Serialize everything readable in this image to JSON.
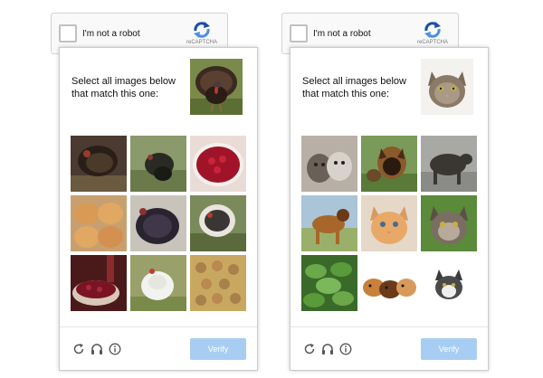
{
  "captchas": [
    {
      "checkbox_label": "I'm not a robot",
      "brand": "reCAPTCHA",
      "prompt": "Select all images below that match this one:",
      "target": "turkey",
      "tiles": [
        "turkey",
        "turkey",
        "cranberries",
        "bread-rolls",
        "turkey",
        "turkey",
        "cranberry-dish",
        "turkey",
        "nuts"
      ],
      "footer_icons": [
        "refresh-icon",
        "headphones-icon",
        "info-icon"
      ],
      "verify_label": "Verify"
    },
    {
      "checkbox_label": "I'm not a robot",
      "brand": "reCAPTCHA",
      "prompt": "Select all images below that match this one:",
      "target": "cat",
      "tiles": [
        "kittens",
        "dog",
        "dog",
        "dog",
        "kitten",
        "cat",
        "plant",
        "guinea-pigs",
        "kitten"
      ],
      "footer_icons": [
        "refresh-icon",
        "headphones-icon",
        "info-icon"
      ],
      "verify_label": "Verify"
    }
  ],
  "colors": {
    "accent": "#a8cdf2",
    "logo_blue": "#4a90e2",
    "logo_dark": "#1a4fa0"
  }
}
